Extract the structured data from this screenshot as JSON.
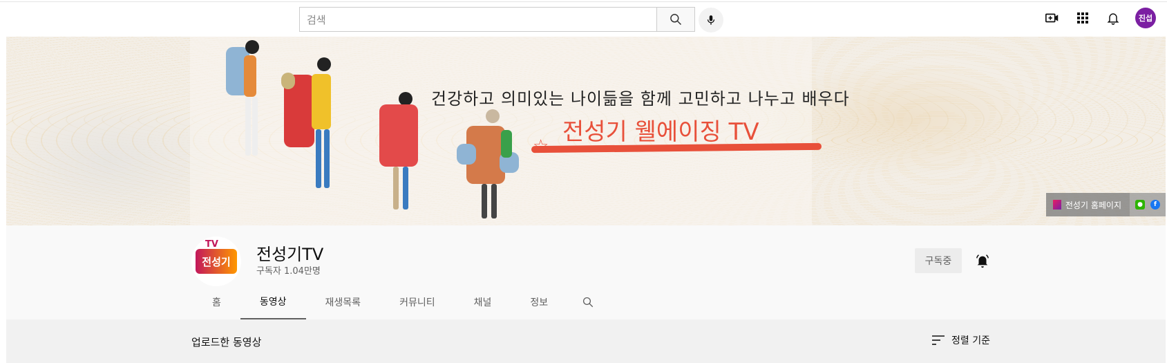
{
  "masthead": {
    "search_placeholder": "검색",
    "avatar_initials": "진섭"
  },
  "banner": {
    "line1": "건강하고 의미있는 나이듦을 함께 고민하고 나누고 배우다",
    "line2": "전성기 웰에이징 TV",
    "homepage_link": "전성기 홈페이지",
    "accent_color": "#e8503a"
  },
  "channel": {
    "name": "전성기TV",
    "subscribers": "구독자 1.04만명",
    "avatar_text": "전성기",
    "avatar_tv": "TV",
    "subscribe_label": "구독중"
  },
  "tabs": [
    {
      "label": "홈",
      "active": false
    },
    {
      "label": "동영상",
      "active": true
    },
    {
      "label": "재생목록",
      "active": false
    },
    {
      "label": "커뮤니티",
      "active": false
    },
    {
      "label": "채널",
      "active": false
    },
    {
      "label": "정보",
      "active": false
    }
  ],
  "content": {
    "section_title": "업로드한 동영상",
    "sort_label": "정렬 기준"
  }
}
